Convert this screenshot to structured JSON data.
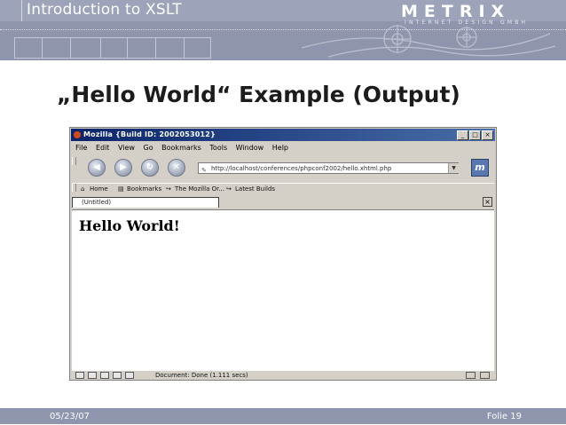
{
  "slide": {
    "title": "Introduction to XSLT",
    "logo": "METRIX",
    "logo_sub": "INTERNET DESIGN GMBH",
    "heading": "„Hello World“ Example (Output)",
    "date": "05/23/07",
    "folie": "Folie 19"
  },
  "browser": {
    "title": "Mozilla {Build ID: 2002053012}",
    "menu": [
      "File",
      "Edit",
      "View",
      "Go",
      "Bookmarks",
      "Tools",
      "Window",
      "Help"
    ],
    "url": "http://localhost/conferences/phpconf2002/hello.xhtml.php",
    "personal_toolbar": [
      "Home",
      "Bookmarks",
      "The Mozilla Or...",
      "Latest Builds"
    ],
    "tab_label": "(Untitled)",
    "page_text": "Hello World!",
    "status": "Document: Done (1.111 secs)"
  },
  "colors": {
    "band": "#8f95ac",
    "titlebar": "#0a246a",
    "chrome": "#d4d0c8"
  }
}
